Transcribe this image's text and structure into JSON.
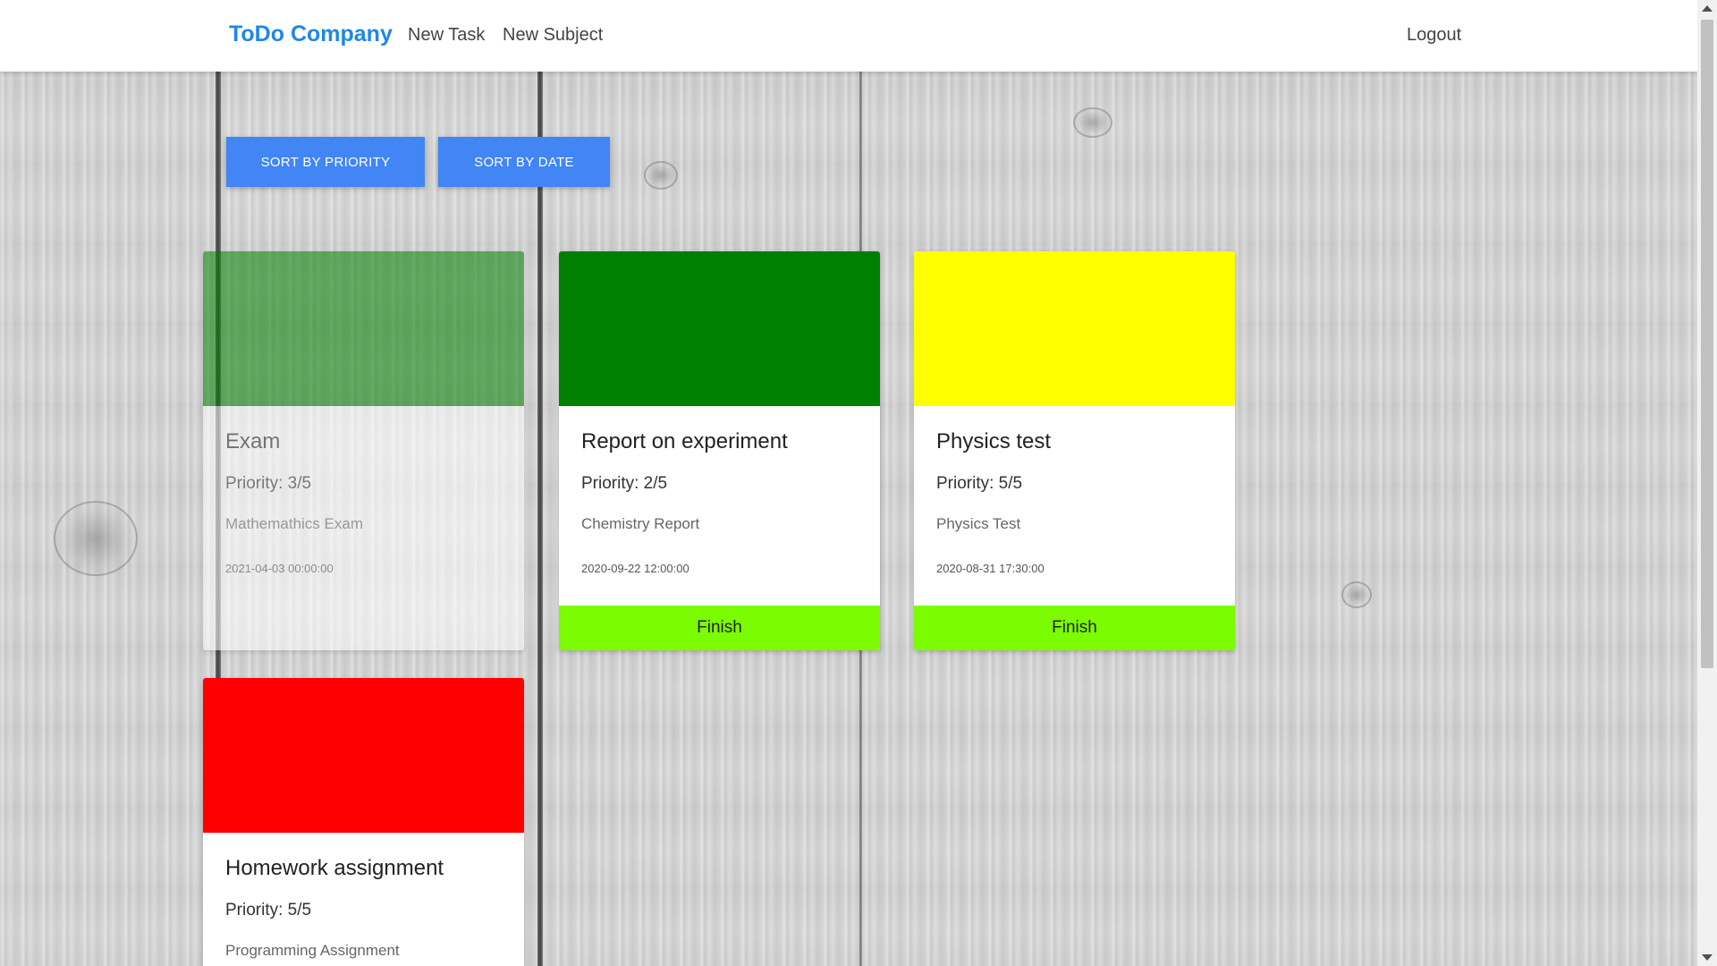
{
  "navbar": {
    "brand": "ToDo Company",
    "new_task": "New Task",
    "new_subject": "New Subject",
    "logout": "Logout",
    "brand_color": "#1e88e5"
  },
  "toolbar": {
    "sort_priority_label": "SORT BY PRIORITY",
    "sort_date_label": "SORT BY DATE",
    "button_color": "#4285f4"
  },
  "tasks": [
    {
      "title": "Exam",
      "priority": "Priority: 3/5",
      "subject": "Mathemathics Exam",
      "date": "2021-04-03 00:00:00",
      "color": "#008000",
      "finished": true
    },
    {
      "title": "Report on experiment",
      "priority": "Priority: 2/5",
      "subject": "Chemistry Report",
      "date": "2020-09-22 12:00:00",
      "color": "#008000",
      "finish_label": "Finish"
    },
    {
      "title": "Physics test",
      "priority": "Priority: 5/5",
      "subject": "Physics Test",
      "date": "2020-08-31 17:30:00",
      "color": "#ffff00",
      "finish_label": "Finish"
    },
    {
      "title": "Homework assignment",
      "priority": "Priority: 5/5",
      "subject": "Programming Assignment",
      "color": "#ff0000"
    }
  ],
  "finish_color": "#7cfc00"
}
